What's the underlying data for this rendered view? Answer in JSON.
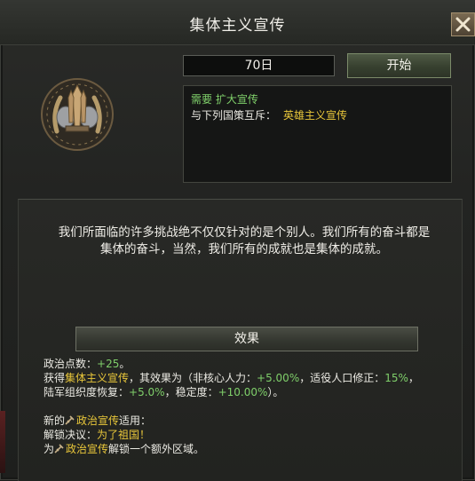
{
  "window": {
    "title": "集体主义宣传"
  },
  "emblem": {
    "icon": "propaganda-emblem-icon"
  },
  "duration": {
    "value": "70日"
  },
  "start_button": {
    "label": "开始"
  },
  "requirements": {
    "line1": "需要 扩大宣传",
    "line2_prefix": "与下列国策互斥：",
    "line2_value": "英雄主义宣传"
  },
  "description": "我们所面临的许多挑战绝不仅仅针对的是个别人。我们所有的奋斗都是集体的奋斗，当然，我们所有的成就也是集体的成就。",
  "effects": {
    "header": "效果",
    "pp_label": "政治点数：",
    "pp_value": "+25",
    "pp_end": "。",
    "gain_prefix": "获得",
    "gain_spirit": "集体主义宣传",
    "gain_mid": "，其效果为（非核心人力：",
    "nc_manpower": "+5.00%",
    "recruit_label": "，适役人口修正：",
    "recruit_value": "15%",
    "recruit_end": "，",
    "org_label": "陆军组织度恢复：",
    "org_value": "+5.0%",
    "stab_label": "，稳定度：",
    "stab_value": "+10.00%",
    "stab_end": "）。",
    "new_prefix": "新的",
    "new_cat": "政治宣传",
    "new_suffix": "适用：",
    "unlock_prefix": "解锁决议：",
    "unlock_decision": "为了祖国！",
    "extra_prefix": "为",
    "extra_cat": "政治宣传",
    "extra_suffix": "解锁一个额外区域。"
  },
  "colors": {
    "positive": "#7fcf6a",
    "highlight": "#e8c63a",
    "background": "#222320"
  }
}
